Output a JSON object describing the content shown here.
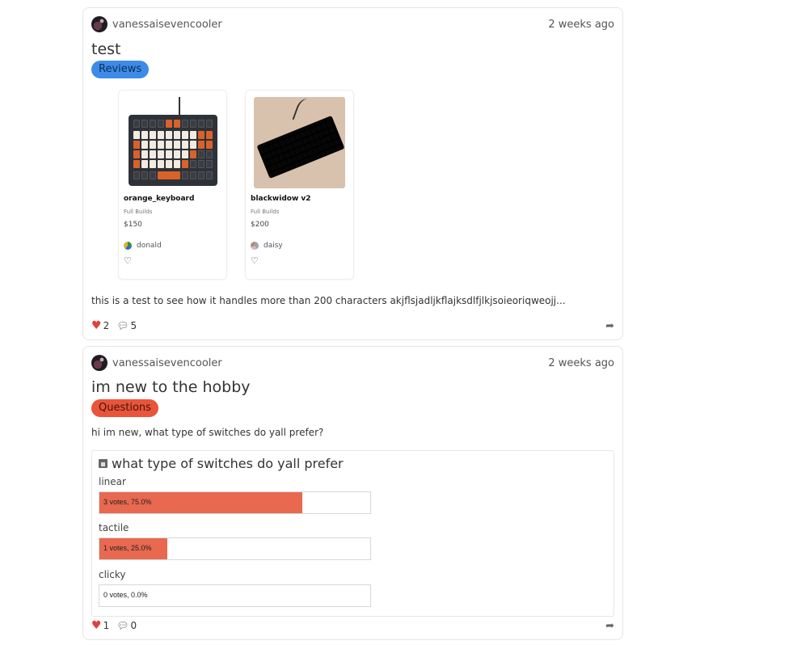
{
  "posts": [
    {
      "username": "vanessaisevencooler",
      "time": "2 weeks ago",
      "title": "test",
      "tag": "Reviews",
      "products": [
        {
          "name": "orange_keyboard",
          "category": "Full Builds",
          "price": "$150",
          "owner": "donald"
        },
        {
          "name": "blackwidow v2",
          "category": "Full Builds",
          "price": "$200",
          "owner": "daisy"
        }
      ],
      "body": "this is a test to see how it handles more than 200 characters akjflsjadljkflajksdlfjlkjsoieoriqweojj...",
      "likes": "2",
      "comments": "5"
    },
    {
      "username": "vanessaisevencooler",
      "time": "2 weeks ago",
      "title": "im new to the hobby",
      "tag": "Questions",
      "body": "hi im new, what type of switches do yall prefer?",
      "poll": {
        "question": "what type of switches do yall prefer",
        "options": [
          {
            "label": "linear",
            "result": "3 votes, 75.0%",
            "share": 0.75
          },
          {
            "label": "tactile",
            "result": "1 votes, 25.0%",
            "share": 0.25
          },
          {
            "label": "clicky",
            "result": "0 votes, 0.0%",
            "share": 0.0
          }
        ]
      },
      "likes": "1",
      "comments": "0"
    }
  ],
  "colors": {
    "like": "#e0403a",
    "reviews_tag": "#3d8be8",
    "questions_tag": "#e8553a",
    "poll_bar": "#e8694f"
  },
  "icons": {
    "like": "heart-icon",
    "comment": "comment-icon",
    "share": "share-icon",
    "poll": "poll-icon"
  }
}
